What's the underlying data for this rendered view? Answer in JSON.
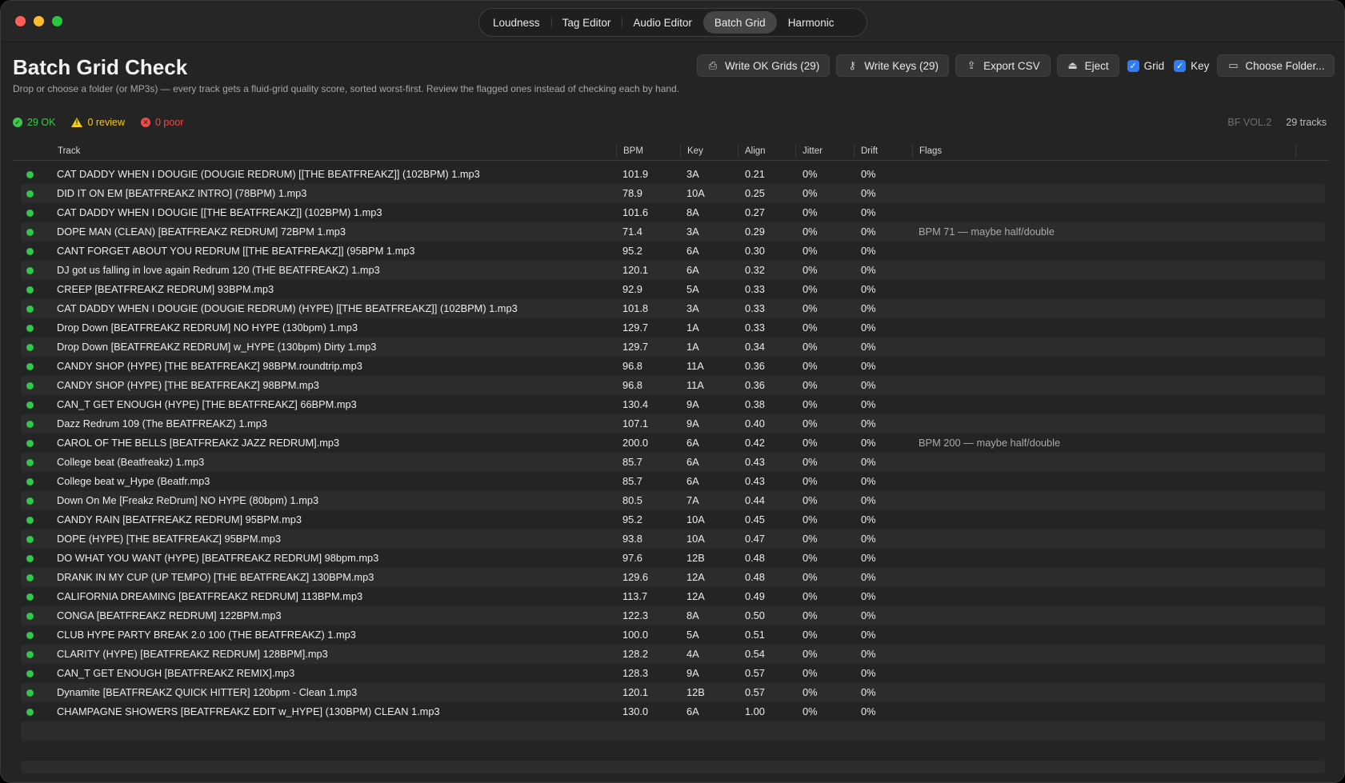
{
  "tabs": [
    {
      "label": "Loudness",
      "active": false
    },
    {
      "label": "Tag Editor",
      "active": false
    },
    {
      "label": "Audio Editor",
      "active": false
    },
    {
      "label": "Batch Grid",
      "active": true
    },
    {
      "label": "Harmonic",
      "active": false
    }
  ],
  "header": {
    "title": "Batch Grid Check",
    "description": "Drop or choose a folder (or MP3s) — every track gets a fluid-grid quality score, sorted worst-first. Review the flagged ones instead of checking each by hand."
  },
  "summary": {
    "ok": "29 OK",
    "review": "0 review",
    "poor": "0 poor",
    "volume": "BF VOL.2",
    "tracks": "29 tracks"
  },
  "toolbar": {
    "write_grids": "Write OK Grids (29)",
    "write_keys": "Write Keys (29)",
    "export_csv": "Export CSV",
    "eject": "Eject",
    "grid_label": "Grid",
    "key_label": "Key",
    "choose_folder": "Choose Folder..."
  },
  "colors": {
    "ok": "#3cc94a",
    "review": "#f4c91d",
    "poor": "#f24a4a",
    "accent": "#2f7cf6"
  },
  "table": {
    "columns": [
      "Track",
      "BPM",
      "Key",
      "Align",
      "Jitter",
      "Drift",
      "Flags"
    ],
    "rows": [
      {
        "track": "CAT DADDY WHEN I DOUGIE (DOUGIE REDRUM) [[THE BEATFREAKZ]] (102BPM) 1.mp3",
        "bpm": "101.9",
        "key": "3A",
        "align": "0.21",
        "jitter": "0%",
        "drift": "0%",
        "flags": ""
      },
      {
        "track": "DID IT ON EM [BEATFREAKZ INTRO] (78BPM) 1.mp3",
        "bpm": "78.9",
        "key": "10A",
        "align": "0.25",
        "jitter": "0%",
        "drift": "0%",
        "flags": ""
      },
      {
        "track": "CAT DADDY WHEN I DOUGIE [[THE BEATFREAKZ]] (102BPM) 1.mp3",
        "bpm": "101.6",
        "key": "8A",
        "align": "0.27",
        "jitter": "0%",
        "drift": "0%",
        "flags": ""
      },
      {
        "track": "DOPE MAN (CLEAN) [BEATFREAKZ REDRUM] 72BPM 1.mp3",
        "bpm": "71.4",
        "key": "3A",
        "align": "0.29",
        "jitter": "0%",
        "drift": "0%",
        "flags": "BPM 71 — maybe half/double"
      },
      {
        "track": "CANT FORGET ABOUT YOU REDRUM [[THE BEATFREAKZ]] (95BPM 1.mp3",
        "bpm": "95.2",
        "key": "6A",
        "align": "0.30",
        "jitter": "0%",
        "drift": "0%",
        "flags": ""
      },
      {
        "track": "DJ got us falling in love again Redrum 120 (THE BEATFREAKZ) 1.mp3",
        "bpm": "120.1",
        "key": "6A",
        "align": "0.32",
        "jitter": "0%",
        "drift": "0%",
        "flags": ""
      },
      {
        "track": "CREEP [BEATFREAKZ REDRUM] 93BPM.mp3",
        "bpm": "92.9",
        "key": "5A",
        "align": "0.33",
        "jitter": "0%",
        "drift": "0%",
        "flags": ""
      },
      {
        "track": "CAT DADDY WHEN I DOUGIE (DOUGIE REDRUM) (HYPE) [[THE BEATFREAKZ]] (102BPM) 1.mp3",
        "bpm": "101.8",
        "key": "3A",
        "align": "0.33",
        "jitter": "0%",
        "drift": "0%",
        "flags": ""
      },
      {
        "track": "Drop Down [BEATFREAKZ REDRUM] NO HYPE (130bpm) 1.mp3",
        "bpm": "129.7",
        "key": "1A",
        "align": "0.33",
        "jitter": "0%",
        "drift": "0%",
        "flags": ""
      },
      {
        "track": "Drop Down [BEATFREAKZ REDRUM] w_HYPE (130bpm) Dirty 1.mp3",
        "bpm": "129.7",
        "key": "1A",
        "align": "0.34",
        "jitter": "0%",
        "drift": "0%",
        "flags": ""
      },
      {
        "track": "CANDY SHOP (HYPE) [THE BEATFREAKZ] 98BPM.roundtrip.mp3",
        "bpm": "96.8",
        "key": "11A",
        "align": "0.36",
        "jitter": "0%",
        "drift": "0%",
        "flags": ""
      },
      {
        "track": "CANDY SHOP (HYPE) [THE BEATFREAKZ] 98BPM.mp3",
        "bpm": "96.8",
        "key": "11A",
        "align": "0.36",
        "jitter": "0%",
        "drift": "0%",
        "flags": ""
      },
      {
        "track": "CAN_T GET ENOUGH (HYPE) [THE BEATFREAKZ] 66BPM.mp3",
        "bpm": "130.4",
        "key": "9A",
        "align": "0.38",
        "jitter": "0%",
        "drift": "0%",
        "flags": ""
      },
      {
        "track": "Dazz Redrum 109 (The BEATFREAKZ) 1.mp3",
        "bpm": "107.1",
        "key": "9A",
        "align": "0.40",
        "jitter": "0%",
        "drift": "0%",
        "flags": ""
      },
      {
        "track": "CAROL OF THE BELLS [BEATFREAKZ JAZZ REDRUM].mp3",
        "bpm": "200.0",
        "key": "6A",
        "align": "0.42",
        "jitter": "0%",
        "drift": "0%",
        "flags": "BPM 200 — maybe half/double"
      },
      {
        "track": "College beat (Beatfreakz) 1.mp3",
        "bpm": "85.7",
        "key": "6A",
        "align": "0.43",
        "jitter": "0%",
        "drift": "0%",
        "flags": ""
      },
      {
        "track": "College beat w_Hype (Beatfr.mp3",
        "bpm": "85.7",
        "key": "6A",
        "align": "0.43",
        "jitter": "0%",
        "drift": "0%",
        "flags": ""
      },
      {
        "track": "Down On Me [Freakz ReDrum] NO HYPE (80bpm) 1.mp3",
        "bpm": "80.5",
        "key": "7A",
        "align": "0.44",
        "jitter": "0%",
        "drift": "0%",
        "flags": ""
      },
      {
        "track": "CANDY RAIN [BEATFREAKZ REDRUM] 95BPM.mp3",
        "bpm": "95.2",
        "key": "10A",
        "align": "0.45",
        "jitter": "0%",
        "drift": "0%",
        "flags": ""
      },
      {
        "track": "DOPE (HYPE) [THE BEATFREAKZ] 95BPM.mp3",
        "bpm": "93.8",
        "key": "10A",
        "align": "0.47",
        "jitter": "0%",
        "drift": "0%",
        "flags": ""
      },
      {
        "track": "DO WHAT YOU WANT (HYPE) [BEATFREAKZ REDRUM] 98bpm.mp3",
        "bpm": "97.6",
        "key": "12B",
        "align": "0.48",
        "jitter": "0%",
        "drift": "0%",
        "flags": ""
      },
      {
        "track": "DRANK IN MY CUP (UP TEMPO) [THE BEATFREAKZ] 130BPM.mp3",
        "bpm": "129.6",
        "key": "12A",
        "align": "0.48",
        "jitter": "0%",
        "drift": "0%",
        "flags": ""
      },
      {
        "track": "CALIFORNIA DREAMING [BEATFREAKZ REDRUM] 113BPM.mp3",
        "bpm": "113.7",
        "key": "12A",
        "align": "0.49",
        "jitter": "0%",
        "drift": "0%",
        "flags": ""
      },
      {
        "track": "CONGA [BEATFREAKZ REDRUM] 122BPM.mp3",
        "bpm": "122.3",
        "key": "8A",
        "align": "0.50",
        "jitter": "0%",
        "drift": "0%",
        "flags": ""
      },
      {
        "track": "CLUB HYPE PARTY BREAK 2.0 100 (THE BEATFREAKZ) 1.mp3",
        "bpm": "100.0",
        "key": "5A",
        "align": "0.51",
        "jitter": "0%",
        "drift": "0%",
        "flags": ""
      },
      {
        "track": "CLARITY (HYPE) [BEATFREAKZ REDRUM] 128BPM].mp3",
        "bpm": "128.2",
        "key": "4A",
        "align": "0.54",
        "jitter": "0%",
        "drift": "0%",
        "flags": ""
      },
      {
        "track": "CAN_T GET ENOUGH [BEATFREAKZ REMIX].mp3",
        "bpm": "128.3",
        "key": "9A",
        "align": "0.57",
        "jitter": "0%",
        "drift": "0%",
        "flags": ""
      },
      {
        "track": "Dynamite [BEATFREAKZ QUICK HITTER] 120bpm - Clean 1.mp3",
        "bpm": "120.1",
        "key": "12B",
        "align": "0.57",
        "jitter": "0%",
        "drift": "0%",
        "flags": ""
      },
      {
        "track": "CHAMPAGNE SHOWERS [BEATFREAKZ EDIT w_HYPE] (130BPM) CLEAN 1.mp3",
        "bpm": "130.0",
        "key": "6A",
        "align": "1.00",
        "jitter": "0%",
        "drift": "0%",
        "flags": ""
      }
    ]
  }
}
